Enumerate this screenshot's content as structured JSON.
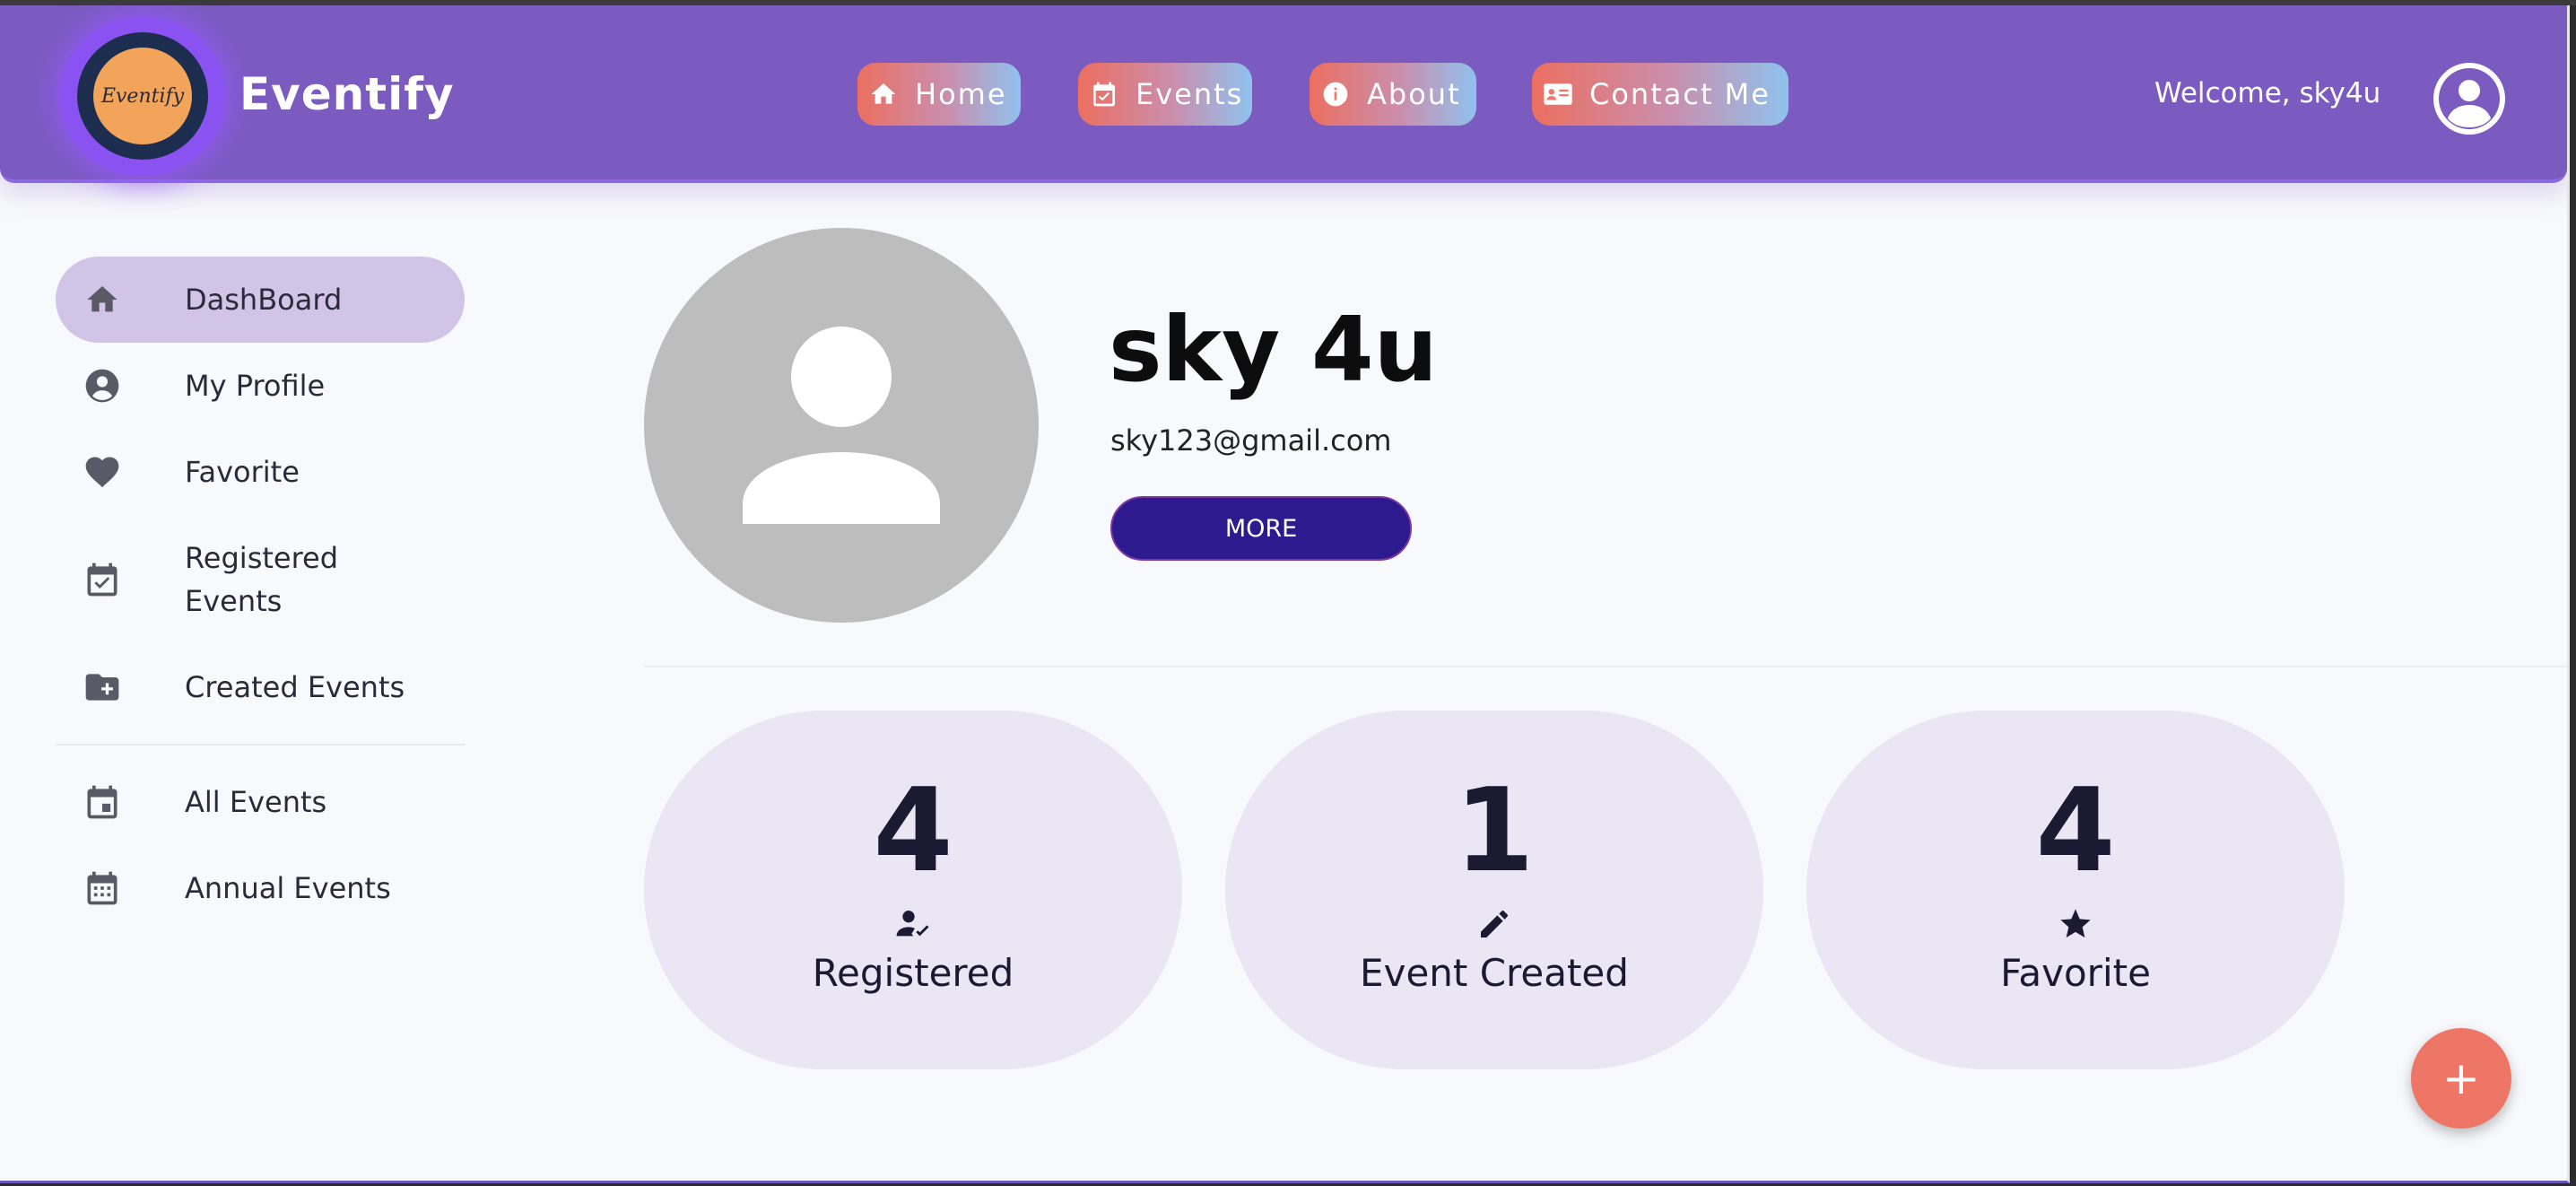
{
  "header": {
    "logo_text": "Eventify",
    "brand": "Eventify",
    "nav": [
      {
        "label": "Home",
        "icon": "home-icon"
      },
      {
        "label": "Events",
        "icon": "calendar-check-icon"
      },
      {
        "label": "About",
        "icon": "info-icon"
      },
      {
        "label": "Contact Me",
        "icon": "contact-card-icon"
      }
    ],
    "welcome": "Welcome, sky4u"
  },
  "sidebar": {
    "items": [
      {
        "label": "DashBoard",
        "icon": "home-icon",
        "active": true
      },
      {
        "label": "My Profile",
        "icon": "account-circle-icon"
      },
      {
        "label": "Favorite",
        "icon": "heart-icon"
      },
      {
        "label": "Registered Events",
        "icon": "calendar-check-icon"
      },
      {
        "label": "Created Events",
        "icon": "folder-plus-icon"
      },
      {
        "label": "All Events",
        "icon": "calendar-icon"
      },
      {
        "label": "Annual Events",
        "icon": "calendar-month-icon"
      }
    ]
  },
  "profile": {
    "name": "sky 4u",
    "email": "sky123@gmail.com",
    "more_label": "MORE"
  },
  "stats": [
    {
      "value": "4",
      "label": "Registered",
      "icon": "user-check-icon"
    },
    {
      "value": "1",
      "label": "Event Created",
      "icon": "pencil-icon"
    },
    {
      "value": "4",
      "label": "Favorite",
      "icon": "star-icon"
    }
  ],
  "fab": {
    "label": "+"
  },
  "colors": {
    "header": "#7b5bbf",
    "sidebar_active": "#d1c4e6",
    "stat_card": "#ebe6f3",
    "more_button": "#2e1a8f",
    "fab": "#ee7666",
    "logo_core": "#f2a55a"
  }
}
